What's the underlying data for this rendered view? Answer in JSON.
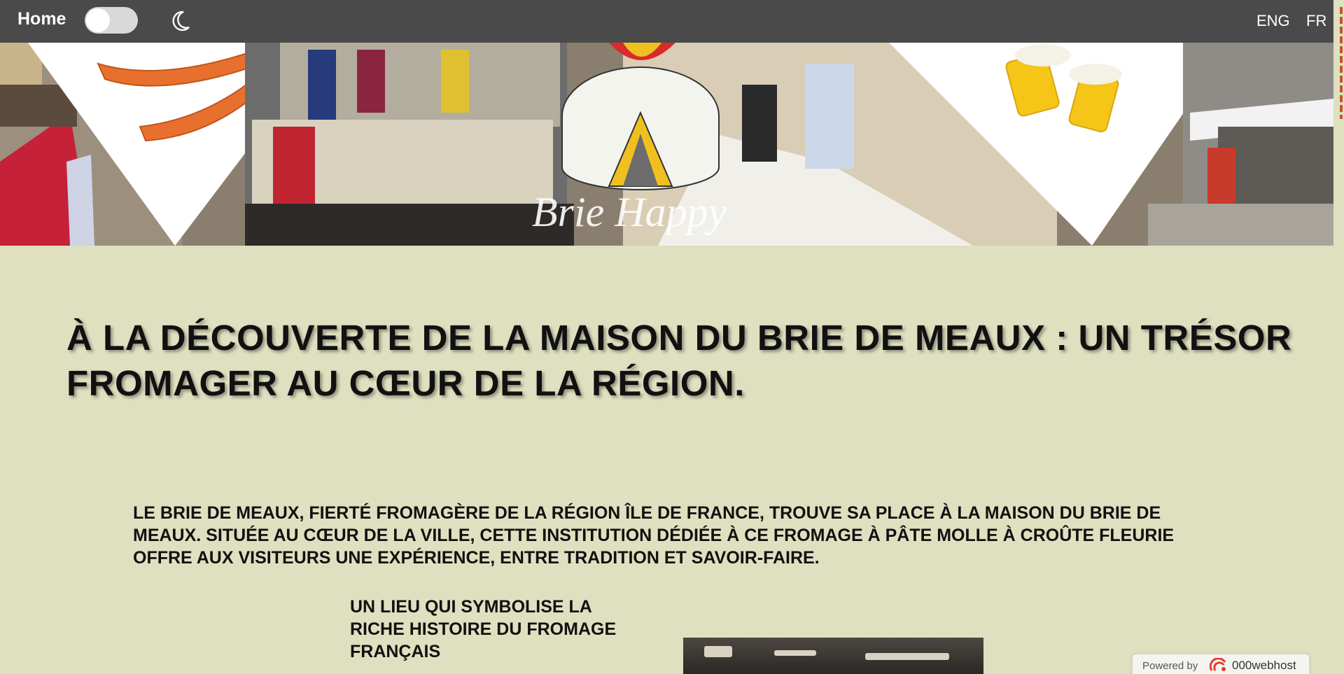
{
  "nav": {
    "home_label": "Home",
    "lang_eng": "ENG",
    "lang_fr": "FR",
    "theme_icon": "moon-icon"
  },
  "banner": {
    "logo_text": "Brie Happy"
  },
  "main": {
    "title": "À LA DÉCOUVERTE DE LA MAISON DU BRIE DE MEAUX : UN TRÉSOR FROMAGER AU CŒUR DE LA RÉGION.",
    "intro": "LE BRIE DE MEAUX, FIERTÉ FROMAGÈRE DE LA RÉGION ÎLE DE FRANCE, TROUVE SA PLACE À LA MAISON DU BRIE DE MEAUX. SITUÉE AU CŒUR DE LA VILLE, CETTE INSTITUTION DÉDIÉE À CE FROMAGE À PÂTE MOLLE À CROÛTE FLEURIE OFFRE AUX VISITEURS UNE EXPÉRIENCE, ENTRE TRADITION ET SAVOIR-FAIRE.",
    "subheading": "UN LIEU QUI SYMBOLISE LA RICHE HISTOIRE DU FROMAGE FRANÇAIS"
  },
  "footer_badge": {
    "powered_label": "Powered by",
    "brand": "000webhost"
  },
  "colors": {
    "page_bg": "#dfe0c0",
    "nav_bg": "#4a4a4a",
    "text": "#111111"
  }
}
